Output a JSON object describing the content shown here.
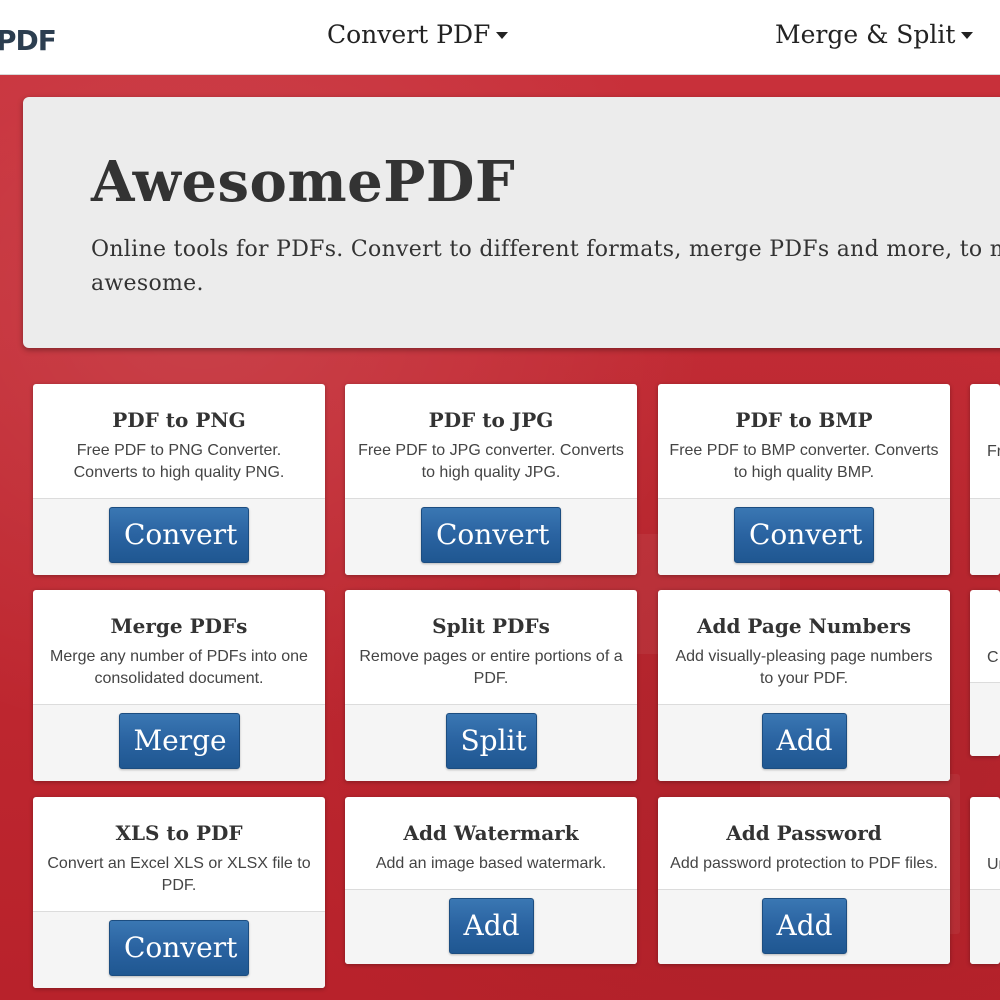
{
  "navbar": {
    "logo_text": "PDF",
    "items": [
      {
        "label": "Convert PDF"
      },
      {
        "label": "Merge & Split"
      }
    ]
  },
  "hero": {
    "title": "AwesomePDF",
    "subtitle": "Online tools for PDFs. Convert to different formats, merge PDFs and more, to ma awesome."
  },
  "cards": [
    {
      "title": "PDF to PNG",
      "description": "Free PDF to PNG Converter. Converts to high quality PNG.",
      "button": "Convert"
    },
    {
      "title": "PDF to JPG",
      "description": "Free PDF to JPG converter. Converts to high quality JPG.",
      "button": "Convert"
    },
    {
      "title": "PDF to BMP",
      "description": "Free PDF to BMP converter. Converts to high quality BMP.",
      "button": "Convert"
    },
    {
      "title": "Merge PDFs",
      "description": "Merge any number of PDFs into one consolidated document.",
      "button": "Merge"
    },
    {
      "title": "Split PDFs",
      "description": "Remove pages or entire portions of a PDF.",
      "button": "Split"
    },
    {
      "title": "Add Page Numbers",
      "description": "Add visually-pleasing page numbers to your PDF.",
      "button": "Add"
    },
    {
      "title": "XLS to PDF",
      "description": "Convert an Excel XLS or XLSX file to PDF.",
      "button": "Convert"
    },
    {
      "title": "Add Watermark",
      "description": "Add an image based watermark.",
      "button": "Add"
    },
    {
      "title": "Add Password",
      "description": "Add password protection to PDF files.",
      "button": "Add"
    }
  ],
  "partial_cards": [
    {
      "description_fragment": "Fr"
    },
    {
      "description_fragment": "C"
    },
    {
      "description_fragment": "Ur"
    }
  ]
}
